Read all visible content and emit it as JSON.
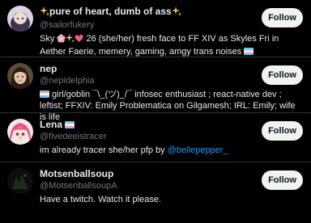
{
  "users": [
    {
      "name_prefix": "✨",
      "name": "pure of heart, dumb of ass",
      "name_suffix": "✨",
      "handle": "@sailorfukery",
      "bio_a": "Sky ",
      "bio_b": " 26 (she/her) fresh face to FF XIV as Skyles Fri in Aether Faerie, memery, gaming, amgy trans noises ",
      "follow_label": "Follow"
    },
    {
      "name": "nep",
      "handle": "@nepidelphia",
      "bio_a": " girl/goblin ¯\\_(ツ)_/¯ infosec enthusiast ; react-native dev ; leftist; FFXIV: Emily Problematica on Gilgamesh; IRL: Emily; wife is life",
      "follow_label": "Follow"
    },
    {
      "name": "Lena",
      "handle": "@fivedeeistracer",
      "bio_a": "im already tracer she/her pfp by ",
      "mention": "@bellepepper_",
      "follow_label": "Follow"
    },
    {
      "name": "Motsenballsoup",
      "handle": "@MotsenballsoupA",
      "bio_a": "Have a twitch. Watch it please.",
      "follow_label": "Follow"
    }
  ],
  "colors": {
    "background": "#000000",
    "divider": "#2f3336",
    "secondary_text": "#71767b",
    "link": "#1d9bf0",
    "follow_button": "#eff3f4"
  },
  "icons": [
    "sparkles-icon",
    "cherry-blossom-icon",
    "sparkling-heart-icon",
    "trans-flag-icon"
  ]
}
